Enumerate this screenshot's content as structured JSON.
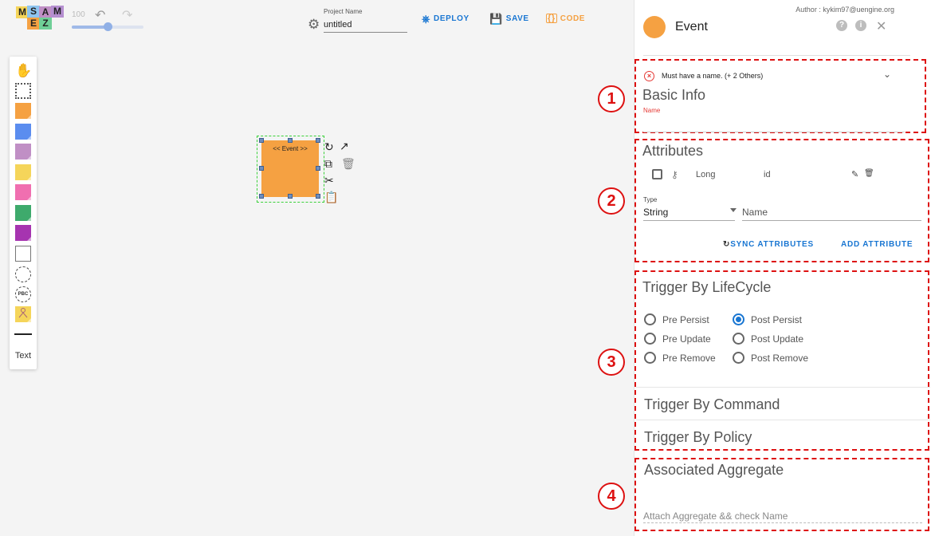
{
  "toolbar": {
    "logo_letters": [
      "M",
      "S",
      "A",
      "E",
      "Z"
    ],
    "zoom": "100",
    "zoom_fraction": 0.5,
    "project_label": "Project Name",
    "project_name": "untitled",
    "deploy_label": "DEPLOY",
    "save_label": "SAVE",
    "code_label": "CODE",
    "colors": {
      "accent": "#1976d2",
      "code": "#f5a142"
    }
  },
  "palette": {
    "items": [
      {
        "name": "hand-icon"
      },
      {
        "name": "lasso-select-icon"
      },
      {
        "name": "sticker-event",
        "color": "#f5a142"
      },
      {
        "name": "sticker-command",
        "color": "#5b8def"
      },
      {
        "name": "sticker-aggregate",
        "color": "#c08fc5"
      },
      {
        "name": "sticker-policy",
        "color": "#f5d55a"
      },
      {
        "name": "sticker-external",
        "color": "#f06fb0"
      },
      {
        "name": "sticker-view",
        "color": "#3eaa6c"
      },
      {
        "name": "sticker-actor",
        "color": "#a634b0"
      },
      {
        "name": "sticker-ui",
        "color": "#ffffff"
      },
      {
        "name": "bounded-context-icon"
      },
      {
        "name": "pbc-icon"
      },
      {
        "name": "sticker-actor-person",
        "color": "#f5d55a"
      },
      {
        "name": "line-icon"
      }
    ],
    "pbc_label": "PBC",
    "text_label": "Text"
  },
  "canvas": {
    "event_label": "<< Event >>"
  },
  "panel": {
    "author": "Author : kykim97@uengine.org",
    "title": "Event",
    "help_icon": "?",
    "info_icon": "i",
    "sections": {
      "basic": {
        "number": "1",
        "error": "Must have a name. (+ 2 Others)",
        "title": "Basic Info",
        "name_label": "Name",
        "name_value": ""
      },
      "attributes": {
        "number": "2",
        "title": "Attributes",
        "rows": [
          {
            "type": "Long",
            "name": "id"
          }
        ],
        "type_label": "Type",
        "type_value": "String",
        "name_placeholder": "Name",
        "sync_label": "SYNC ATTRIBUTES",
        "add_label": "ADD ATTRIBUTE"
      },
      "lifecycle": {
        "number": "3",
        "title": "Trigger By LifeCycle",
        "options": [
          "Pre Persist",
          "Post Persist",
          "Pre Update",
          "Post Update",
          "Pre Remove",
          "Post Remove"
        ],
        "selected": "Post Persist",
        "command_title": "Trigger By Command",
        "policy_title": "Trigger By Policy"
      },
      "aggregate": {
        "number": "4",
        "title": "Associated Aggregate",
        "placeholder": "Attach Aggregate && check Name"
      }
    }
  }
}
